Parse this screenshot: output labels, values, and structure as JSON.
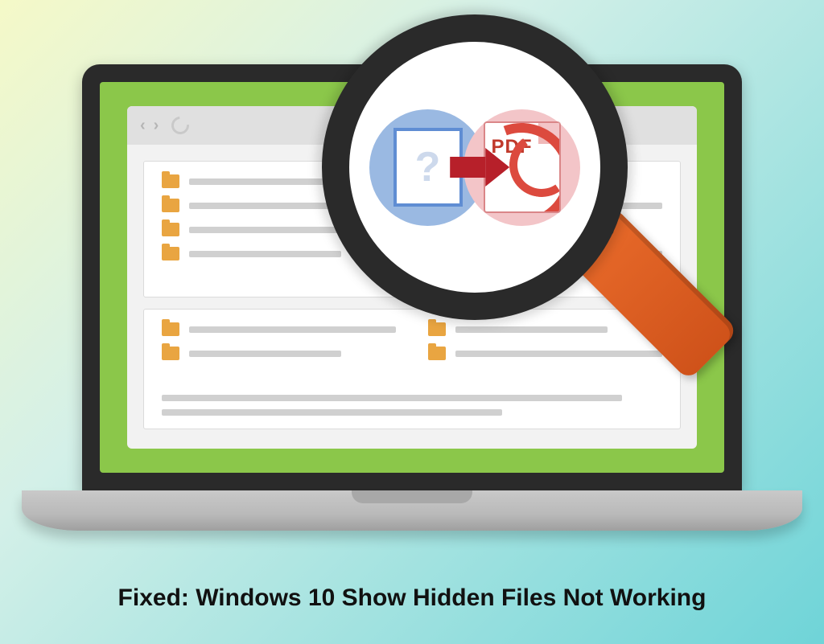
{
  "caption": "Fixed: Windows 10 Show Hidden Files Not Working",
  "magnifier": {
    "doc_question": "?",
    "pdf_label": "PDF"
  },
  "icons": {
    "back": "‹",
    "forward": "›"
  }
}
